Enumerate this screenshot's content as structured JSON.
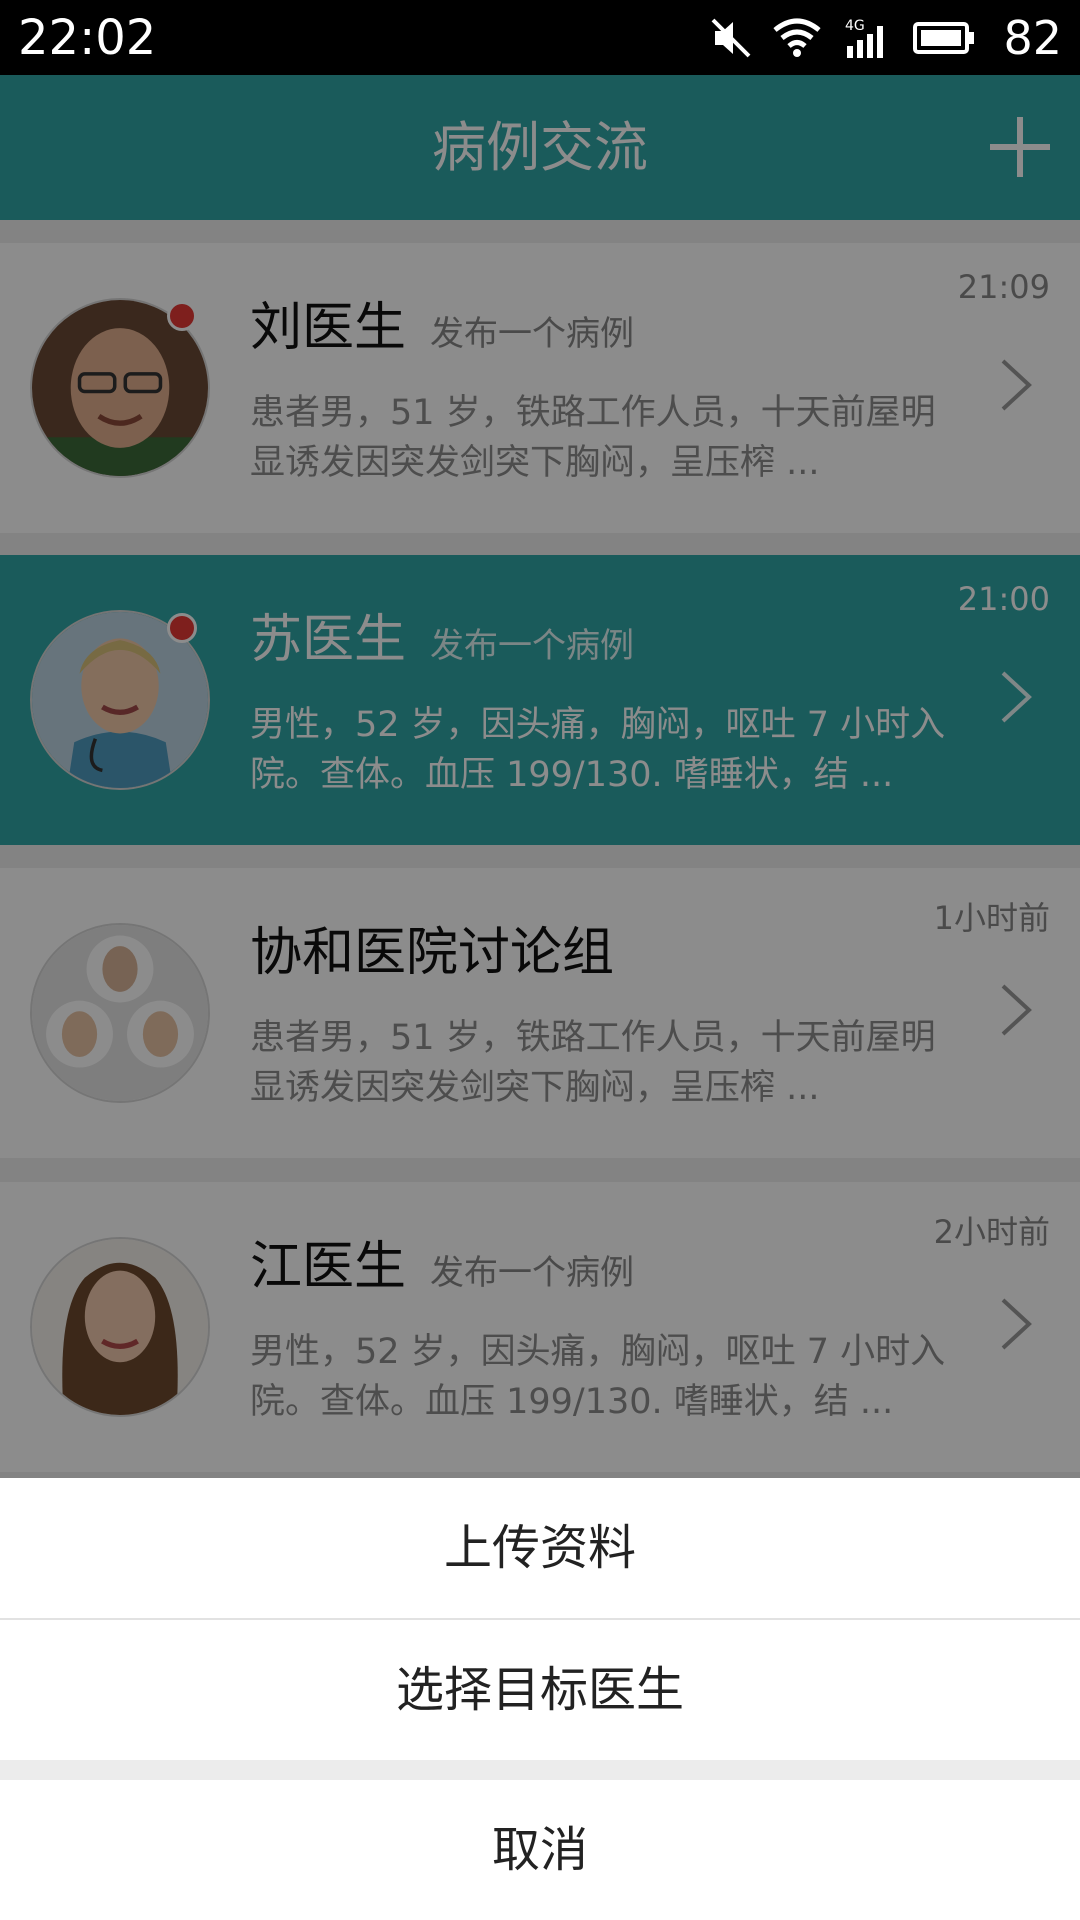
{
  "status_bar": {
    "time": "22:02",
    "battery": "82",
    "icons": [
      "mute-icon",
      "wifi-icon",
      "signal-4g-icon",
      "battery-icon"
    ]
  },
  "header": {
    "title": "病例交流",
    "add_icon": "plus-icon",
    "background": "#31a6a6"
  },
  "cases": [
    {
      "name": "刘医生",
      "action": "发布一个病例",
      "time": "21:09",
      "summary": "患者男，51 岁，铁路工作人员，十天前屋明显诱发因突发剑突下胸闷，呈压榨 ...",
      "unread": true
    },
    {
      "name": "苏医生",
      "action": "发布一个病例",
      "time": "21:00",
      "summary": "男性，52 岁，因头痛，胸闷，呕吐 7 小时入院。查体。血压 199/130. 嗜睡状，结 ...",
      "unread": true
    },
    {
      "name": "协和医院讨论组",
      "action": "",
      "time": "1小时前",
      "summary": "患者男，51 岁，铁路工作人员，十天前屋明显诱发因突发剑突下胸闷，呈压榨 ...",
      "unread": false
    },
    {
      "name": "江医生",
      "action": "发布一个病例",
      "time": "2小时前",
      "summary": "男性，52 岁，因头痛，胸闷，呕吐 7 小时入院。查体。血压 199/130. 嗜睡状，结 ...",
      "unread": false
    }
  ],
  "action_sheet": {
    "upload": "上传资料",
    "select_doctor": "选择目标医生",
    "cancel": "取消"
  }
}
